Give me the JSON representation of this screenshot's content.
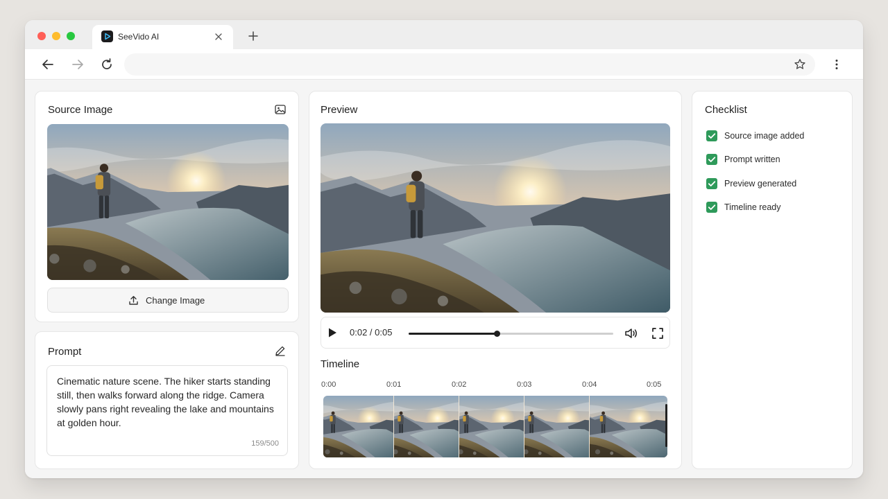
{
  "browser": {
    "tab_title": "SeeVido AI",
    "url": "",
    "colors": {
      "close": "#ff5f57",
      "minimize": "#febc2e",
      "maximize": "#28c840"
    }
  },
  "source_image": {
    "title": "Source Image",
    "change_button": "Change Image"
  },
  "prompt": {
    "title": "Prompt",
    "text": "Cinematic nature scene. The hiker starts standing still, then walks forward along the ridge. Camera slowly pans right revealing the lake and mountains at golden hour.",
    "counter": "159/500"
  },
  "preview": {
    "title": "Preview",
    "time_display": "0:02 / 0:05",
    "progress": 0.43
  },
  "timeline": {
    "title": "Timeline",
    "ticks": [
      "0:00",
      "0:01",
      "0:02",
      "0:03",
      "0:04",
      "0:05"
    ],
    "frames": 5
  },
  "checklist": {
    "title": "Checklist",
    "items": [
      {
        "label": "Source image added",
        "checked": true
      },
      {
        "label": "Prompt written",
        "checked": true
      },
      {
        "label": "Preview generated",
        "checked": true
      },
      {
        "label": "Timeline ready",
        "checked": true
      }
    ],
    "check_color": "#2e9a5a"
  }
}
